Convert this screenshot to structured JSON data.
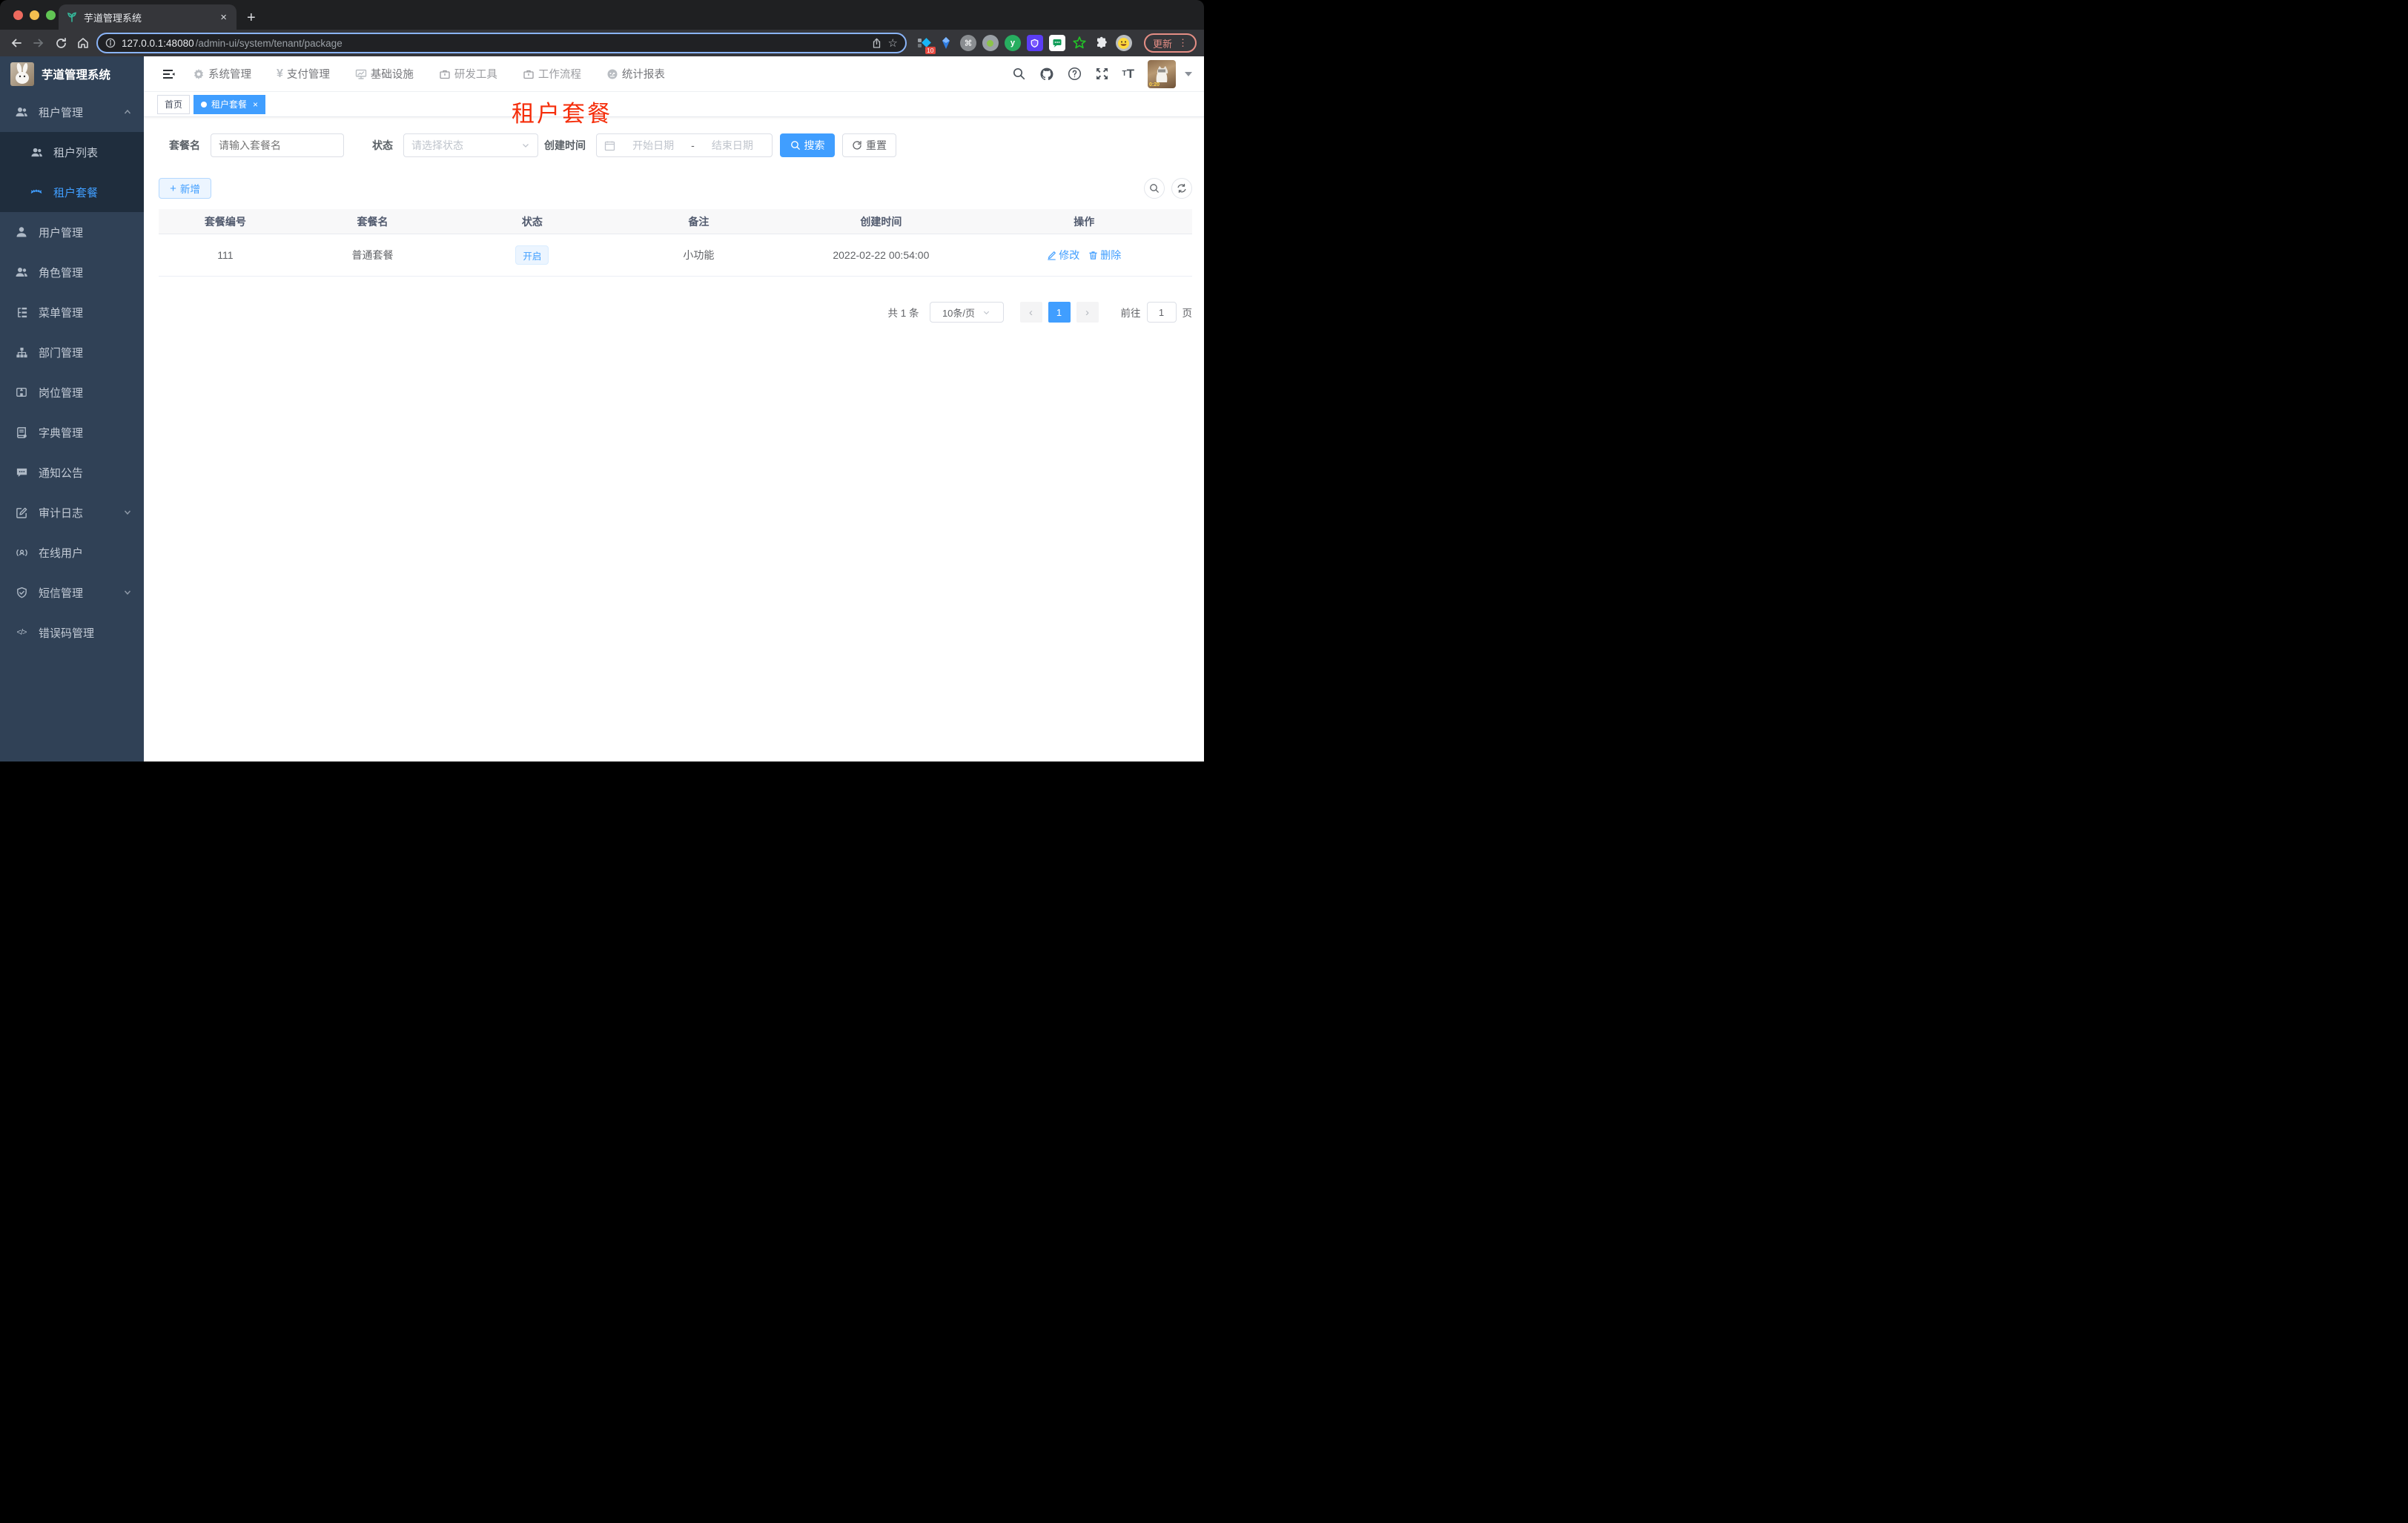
{
  "browser": {
    "tab_title": "芋道管理系统",
    "close_glyph": "×",
    "new_tab_glyph": "+",
    "url_host": "127.0.0.1:48080",
    "url_path": "/admin-ui/system/tenant/package",
    "star_glyph": "☆",
    "ext_badge": "10",
    "cmd_glyph": "⌘",
    "y_glyph": "y",
    "update_label": "更新",
    "menu_dots": "⋮"
  },
  "app_header": {
    "nav": [
      {
        "label": "系统管理"
      },
      {
        "label": "支付管理"
      },
      {
        "label": "基础设施"
      },
      {
        "label": "研发工具"
      },
      {
        "label": "工作流程"
      },
      {
        "label": "统计报表"
      }
    ],
    "yen_glyph": "¥",
    "help_glyph": "?",
    "font_small": "T",
    "font_big": "T",
    "avatar_caption": "0:20"
  },
  "sidebar": {
    "logo_title": "芋道管理系统",
    "items": [
      {
        "label": "租户管理"
      },
      {
        "label": "租户列表"
      },
      {
        "label": "租户套餐"
      },
      {
        "label": "用户管理"
      },
      {
        "label": "角色管理"
      },
      {
        "label": "菜单管理"
      },
      {
        "label": "部门管理"
      },
      {
        "label": "岗位管理"
      },
      {
        "label": "字典管理"
      },
      {
        "label": "通知公告"
      },
      {
        "label": "审计日志"
      },
      {
        "label": "在线用户"
      },
      {
        "label": "短信管理"
      },
      {
        "label": "错误码管理"
      }
    ],
    "code_glyph": "</>"
  },
  "tags": {
    "home": "首页",
    "active": "租户套餐",
    "close_glyph": "×"
  },
  "page_annotation": "租户套餐",
  "search": {
    "name_label": "套餐名",
    "name_placeholder": "请输入套餐名",
    "status_label": "状态",
    "status_placeholder": "请选择状态",
    "date_label": "创建时间",
    "date_start": "开始日期",
    "date_separator": "-",
    "date_end": "结束日期",
    "search_label": "搜索",
    "reset_label": "重置"
  },
  "toolbar": {
    "add_label": "新增",
    "plus_glyph": "+"
  },
  "table": {
    "headers": [
      "套餐编号",
      "套餐名",
      "状态",
      "备注",
      "创建时间",
      "操作"
    ],
    "rows": [
      {
        "id": "111",
        "name": "普通套餐",
        "status": "开启",
        "remark": "小功能",
        "created": "2022-02-22 00:54:00",
        "edit": "修改",
        "delete": "删除"
      }
    ]
  },
  "pagination": {
    "total": "共 1 条",
    "page_size": "10条/页",
    "prev_glyph": "‹",
    "page": "1",
    "next_glyph": "›",
    "goto_label": "前往",
    "goto_value": "1",
    "unit_label": "页"
  },
  "colors": {
    "primary": "#409eff",
    "sidebar_bg": "#304156",
    "submenu_bg": "#1f2d3d",
    "annotation_red": "#f52d0a",
    "tag_active": "#409eff",
    "status_tag_bg": "#ecf5ff"
  }
}
